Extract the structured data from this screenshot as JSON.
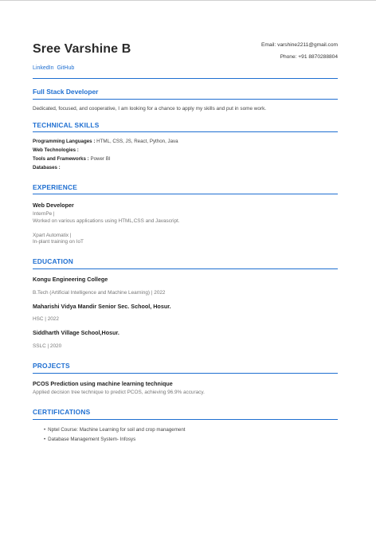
{
  "header": {
    "name": "Sree Varshine B",
    "email": "Email: varshine2211@gmail.com",
    "phone": "Phone: +91 8870288804",
    "links": [
      "LinkedIn",
      "GitHub"
    ]
  },
  "summary": {
    "title": "Full Stack Developer",
    "text": "Dedicated, focused, and cooperative, I am looking for a chance to apply my skills and put in some work."
  },
  "skills": {
    "title": "TECHNICAL SKILLS",
    "rows": [
      {
        "label": "Programming  Languages :",
        "value": " HTML, CSS, JS, React, Python, Java"
      },
      {
        "label": "Web Technologies :",
        "value": ""
      },
      {
        "label": "Tools and Frameworks :",
        "value": " Power BI"
      },
      {
        "label": "Databases :",
        "value": ""
      }
    ]
  },
  "experience": {
    "title": "EXPERIENCE",
    "role": "Web Developer",
    "company1": "InternPe |",
    "desc1": "Worked on various applications using HTML,CSS and Javascript.",
    "company2": "Xpart Automatix |",
    "desc2": "In-plant training on IoT"
  },
  "education": {
    "title": "EDUCATION",
    "items": [
      {
        "school": "Kongu Engineering College",
        "detail": "B.Tech (Artificial Intelligence and Machine Learning) | 2022"
      },
      {
        "school": "Maharishi Vidya Mandir Senior Sec. School, Hosur.",
        "detail": "HSC | 2022"
      },
      {
        "school": "Siddharth Village School,Hosur.",
        "detail": "SSLC | 2020"
      }
    ]
  },
  "projects": {
    "title": "PROJECTS",
    "name": "PCOS Prediction using machine learning technique",
    "desc": "Applied decision tree technique to predict PCOS, achieving 96.9% accuracy."
  },
  "certifications": {
    "title": "CERTIFICATIONS",
    "items": [
      "Nptel Course: Machine Learning for soil and crop management",
      "Database Management System- Infosys"
    ]
  },
  "colors": {
    "accent": "#1f6fd1",
    "text": "#333333"
  }
}
